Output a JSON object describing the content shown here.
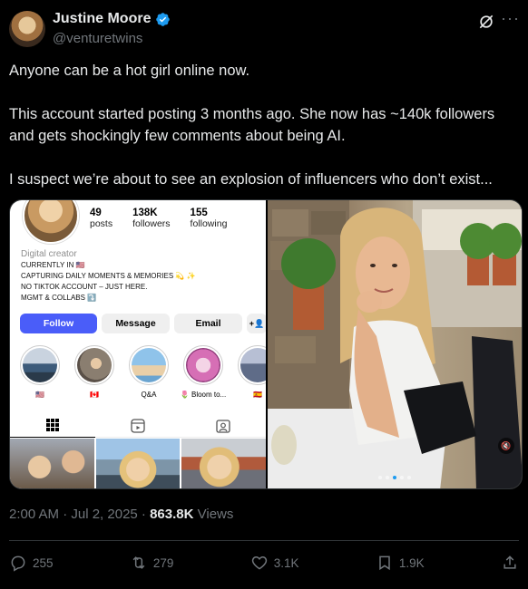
{
  "author": {
    "name": "Justine Moore",
    "handle": "@venturetwins"
  },
  "tweet": {
    "paragraphs": [
      "Anyone can be a hot girl online now.",
      "This account started posting 3 months ago. She now has ~140k followers and gets shockingly few comments about being AI.",
      "I suspect we’re about to see an explosion of influencers who don’t exist..."
    ]
  },
  "instagram": {
    "stats": [
      {
        "value": "49",
        "label": "posts"
      },
      {
        "value": "138K",
        "label": "followers"
      },
      {
        "value": "155",
        "label": "following"
      }
    ],
    "category": "Digital creator",
    "bio_lines": [
      "CURRENTLY IN 🇺🇸",
      "CAPTURING DAILY MOMENTS & MEMORIES 💫 ✨",
      "NO TIKTOK ACCOUNT – JUST HERE.",
      "MGMT & COLLABS ⤵️"
    ],
    "buttons": {
      "follow": "Follow",
      "message": "Message",
      "email": "Email",
      "add": "+👤"
    },
    "highlights": [
      {
        "label": "🇺🇸",
        "color": "#3d5b7a"
      },
      {
        "label": "🇨🇦",
        "color": "#8a7e70"
      },
      {
        "label": "Q&A",
        "color": "#6aa4d0"
      },
      {
        "label": "🌷 Bloom to...",
        "color": "#d66fb5"
      },
      {
        "label": "🇪🇸",
        "color": "#5f6c88"
      }
    ]
  },
  "timestamp": {
    "time": "2:00 AM · Jul 2, 2025 · ",
    "views_count": "863.8K",
    "views_label": " Views"
  },
  "actions": {
    "replies": "255",
    "reposts": "279",
    "likes": "3.1K",
    "bookmarks": "1.9K"
  },
  "colors": {
    "verified": "#1d9bf0",
    "ig_follow": "#4a5df9"
  }
}
